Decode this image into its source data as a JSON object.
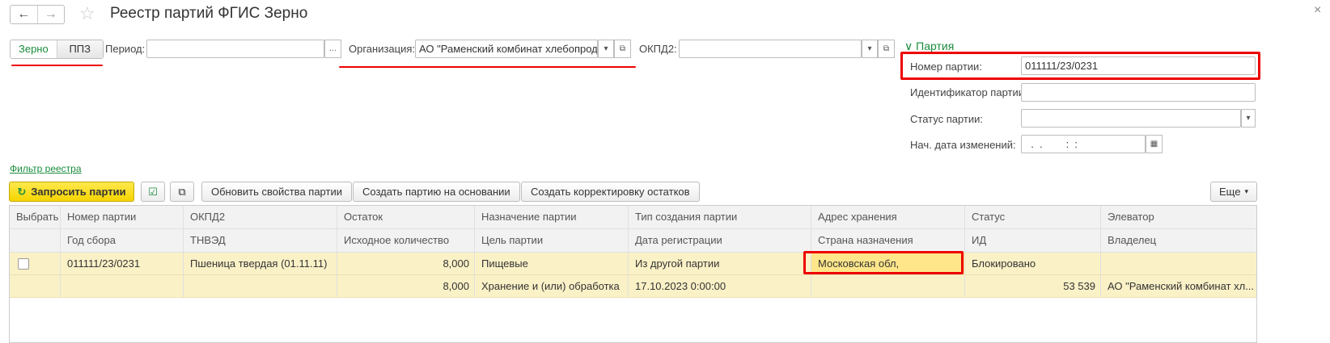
{
  "window": {
    "title": "Реестр партий ФГИС Зерно"
  },
  "nav": {
    "back": "←",
    "forward": "→",
    "star": "☆",
    "close": "×"
  },
  "mode_switch": {
    "grain": "Зерно",
    "ppz": "ППЗ"
  },
  "filters": {
    "period_label": "Период:",
    "period_value": "",
    "org_label": "Организация:",
    "org_value": "АО \"Раменский комбинат хлебопродуктов\"",
    "okpd2_label": "ОКПД2:",
    "okpd2_value": ""
  },
  "party_group": {
    "header": "Партия",
    "number_label": "Номер партии:",
    "number_value": "011111/23/0231",
    "id_label": "Идентификатор партии:",
    "id_value": "",
    "status_label": "Статус партии:",
    "status_value": "",
    "date_label": "Нач. дата изменений:",
    "date_value": "  .  .        :  :"
  },
  "registry_filter_link": "Фильтр реестра",
  "toolbar": {
    "request": "Запросить партии",
    "update": "Обновить свойства партии",
    "create_based": "Создать партию на основании",
    "create_adjust": "Создать корректировку остатков",
    "more": "Еще"
  },
  "table": {
    "headers1": [
      "Выбрать",
      "Номер партии",
      "ОКПД2",
      "Остаток",
      "Назначение партии",
      "Тип создания партии",
      "Адрес хранения",
      "Статус",
      "Элеватор"
    ],
    "headers2": [
      "",
      "Год сбора",
      "ТНВЭД",
      "Исходное количество",
      "Цель партии",
      "Дата регистрации",
      "Страна назначения",
      "ИД",
      "Владелец"
    ],
    "row1": [
      "",
      "011111/23/0231",
      "Пшеница твердая (01.11.11)",
      "8,000",
      "Пищевые",
      "Из другой партии",
      "Московская обл,",
      "Блокировано",
      ""
    ],
    "row2": [
      "",
      "",
      "",
      "8,000",
      "Хранение и (или) обработка",
      "17.10.2023 0:00:00",
      "",
      "53 539",
      "АО \"Раменский комбинат хл..."
    ]
  },
  "colors": {
    "accent_green": "#1a8c3c",
    "highlight_red": "#e00000",
    "row_yellow": "#fbf1c7",
    "button_yellow": "#f5d400"
  }
}
